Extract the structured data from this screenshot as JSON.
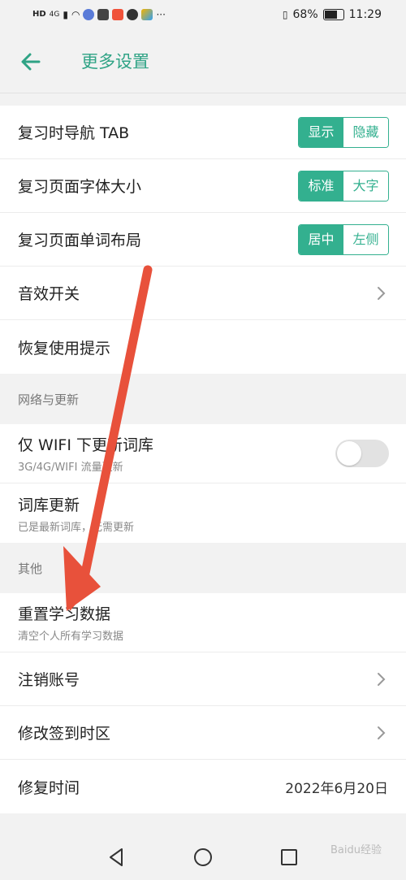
{
  "status_bar": {
    "left_icons": [
      "hd-icon",
      "signal-4g-icon",
      "wifi-icon",
      "app-icon-1",
      "app-icon-2",
      "app-icon-3",
      "app-icon-4",
      "app-icon-5"
    ],
    "network_label": "HD",
    "network_type": "4G",
    "more": "···",
    "vibrate_label": "෿",
    "battery": "68%",
    "time": "11:29"
  },
  "header": {
    "title": "更多设置"
  },
  "settings_top": [
    {
      "title": "复习时导航 TAB",
      "control": "segment",
      "options": [
        "显示",
        "隐藏"
      ],
      "selected": 0
    },
    {
      "title": "复习页面字体大小",
      "control": "segment",
      "options": [
        "标准",
        "大字"
      ],
      "selected": 0
    },
    {
      "title": "复习页面单词布局",
      "control": "segment",
      "options": [
        "居中",
        "左侧"
      ],
      "selected": 0
    },
    {
      "title": "音效开关",
      "control": "chevron"
    },
    {
      "title": "恢复使用提示",
      "control": "none"
    }
  ],
  "section_network": {
    "header": "网络与更新",
    "items": [
      {
        "title": "仅 WIFI 下更新词库",
        "subtitle": "3G/4G/WIFI 流量更新",
        "toggle_on": false
      },
      {
        "title": "词库更新",
        "subtitle": "已是最新词库，无需更新"
      }
    ]
  },
  "section_other": {
    "header": "其他",
    "reset": {
      "title": "重置学习数据",
      "subtitle": "清空个人所有学习数据"
    },
    "items": [
      {
        "title": "注销账号",
        "control": "chevron"
      },
      {
        "title": "修改签到时区",
        "control": "chevron"
      },
      {
        "title": "修复时间",
        "value": "2022年6月20日"
      }
    ]
  },
  "watermark": "Baidu经验",
  "colors": {
    "accent": "#33b08f",
    "title": "#2fa385",
    "arrow": "#e8513b"
  }
}
